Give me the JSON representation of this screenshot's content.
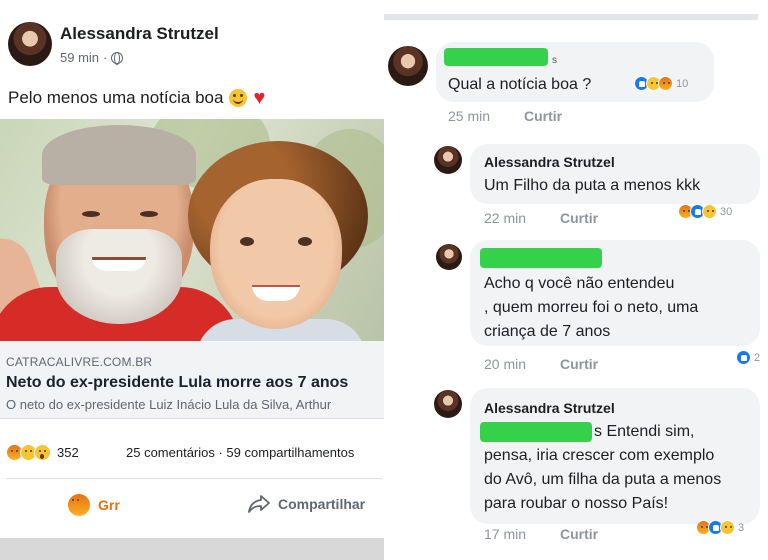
{
  "post": {
    "author": "Alessandra Strutzel",
    "time": "59 min",
    "meta_separator": "·",
    "text": "Pelo menos uma notícia boa",
    "link": {
      "domain": "CATRACALIVRE.COM.BR",
      "title": "Neto do ex-presidente Lula morre aos 7 anos",
      "description": "O neto do ex-presidente Luiz Inácio Lula da Silva, Arthur"
    },
    "reactions_count": "352",
    "comments_shares": "25 comentários · 59 compartilhamentos",
    "actions": {
      "react_label": "Grr",
      "share_label": "Compartilhar"
    }
  },
  "comments": [
    {
      "author_suffix": "s",
      "text": "Qual a notícia boa ?",
      "reaction_count": "10",
      "time": "25 min",
      "like_label": "Curtir"
    },
    {
      "author": "Alessandra Strutzel",
      "text": "Um Filho da puta a menos kkk",
      "reaction_count": "30",
      "time": "22 min",
      "like_label": "Curtir"
    },
    {
      "lines": [
        "Acho q você não entendeu",
        ", quem morreu foi o neto, uma",
        "criança de 7 anos"
      ],
      "reaction_count": "2",
      "time": "20 min",
      "like_label": "Curtir"
    },
    {
      "author": "Alessandra Strutzel",
      "lines": [
        "s Entendi sim,",
        "pensa, iria crescer com exemplo",
        "do Avô, um filha da puta a menos",
        "para roubar o nosso País!"
      ],
      "reaction_count": "3",
      "time": "17 min",
      "like_label": "Curtir"
    }
  ],
  "colors": {
    "redaction": "#35d14a",
    "angry": "#e9710f",
    "like": "#1877f2",
    "heart": "#e0242a"
  },
  "icons": [
    "globe-icon",
    "smile-emoji-icon",
    "heart-icon",
    "angry-reaction-icon",
    "share-arrow-icon"
  ]
}
